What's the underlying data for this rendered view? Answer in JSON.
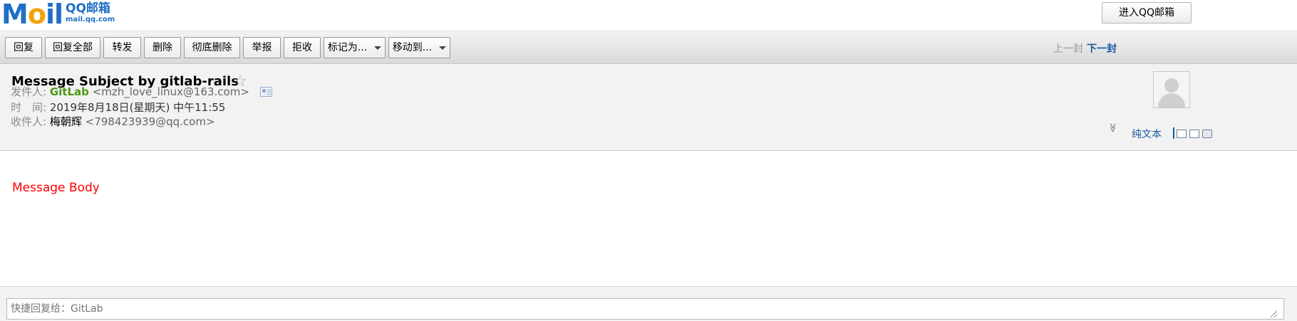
{
  "header": {
    "logo_text": "MOil",
    "logo_cn": "QQ邮箱",
    "logo_url": "mail.qq.com",
    "enter_label": "进入QQ邮箱"
  },
  "toolbar": {
    "reply": "回复",
    "reply_all": "回复全部",
    "forward": "转发",
    "delete": "删除",
    "delete_forever": "彻底删除",
    "report": "举报",
    "reject": "拒收",
    "mark_as": "标记为...",
    "move_to": "移动到...",
    "prev": "上一封",
    "next": "下一封"
  },
  "message": {
    "subject": "Message Subject by gitlab-rails",
    "star": "☆",
    "from_label": "发件人:",
    "from_name": "GitLab",
    "from_addr": "<mzh_love_linux@163.com>",
    "time_label": "时　间:",
    "time_value": "2019年8月18日(星期天) 中午11:55",
    "to_label": "收件人:",
    "to_name": "梅朝辉",
    "to_addr": "<798423939@qq.com>",
    "plain_text": "纯文本",
    "chevron": "≫"
  },
  "body": {
    "text": "Message Body"
  },
  "quick_reply": {
    "placeholder": "快捷回复给：GitLab"
  },
  "colors": {
    "sender": "#4b9a14",
    "link": "#1a5aa0",
    "body_text": "#ff0000",
    "logo_blue": "#1f6fc6",
    "logo_orange": "#f0a30a"
  }
}
